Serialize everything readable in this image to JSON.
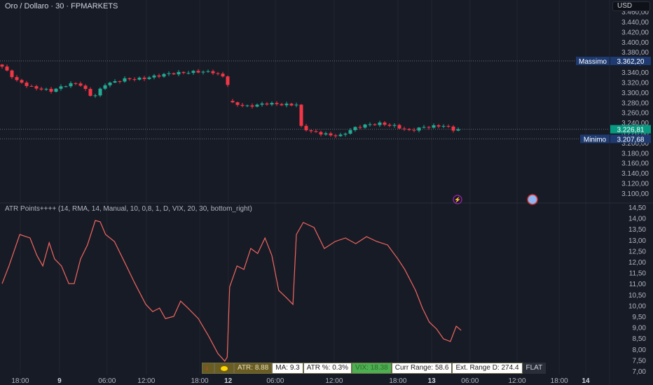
{
  "header": {
    "title": "Oro / Dollaro · 30 · FPMARKETS",
    "currency": "USD"
  },
  "indicator": {
    "label": "ATR Points++++ (14, RMA, 14, Manual, 10, 0,8, 1, D, VIX, 20, 30, bottom_right)"
  },
  "price_labels": {
    "high_label": "Massimo",
    "high_value": "3.362,20",
    "last_value": "3.226,81",
    "low_label": "Minimo",
    "low_value": "3.207,68"
  },
  "table": {
    "atr": "ATR: 8.88",
    "ma": "MA: 9.3",
    "atr_pct": "ATR %: 0.3%",
    "vix": "VIX: 18.38",
    "curr_range": "Curr Range: 58.6",
    "ext_range": "Ext. Range D: 274.4",
    "state": "FLAT",
    "arrow": "↓"
  },
  "colors": {
    "up": "#22ab94",
    "down": "#f23645",
    "atr_line": "#f2665f",
    "label_blue": "#1e3a70",
    "last_green": "#089981",
    "vix_bg": "#4caf50",
    "table_bg": "#6b5d22"
  },
  "chart_data": [
    {
      "type": "candlestick",
      "title": "Oro / Dollaro · 30 · FPMARKETS",
      "ylim": [
        3090,
        3460
      ],
      "yticks": [
        "3.460,00",
        "3.440,00",
        "3.420,00",
        "3.400,00",
        "3.380,00",
        "3.360,00",
        "3.340,00",
        "3.320,00",
        "3.300,00",
        "3.280,00",
        "3.260,00",
        "3.240,00",
        "3.220,00",
        "3.200,00",
        "3.180,00",
        "3.160,00",
        "3.140,00",
        "3.120,00",
        "3.100,00"
      ],
      "ytick_values": [
        3460,
        3440,
        3420,
        3400,
        3380,
        3360,
        3340,
        3320,
        3300,
        3280,
        3260,
        3240,
        3220,
        3200,
        3180,
        3160,
        3140,
        3120,
        3100
      ],
      "close_path": [
        [
          0,
          3351
        ],
        [
          3,
          3323
        ],
        [
          6,
          3310
        ],
        [
          10,
          3303
        ],
        [
          13.5,
          3316
        ],
        [
          15.7,
          3318
        ],
        [
          18.5,
          3289
        ],
        [
          21,
          3316
        ],
        [
          25,
          3326
        ],
        [
          28.5,
          3327
        ],
        [
          34,
          3337
        ],
        [
          40,
          3341
        ],
        [
          43,
          3340
        ],
        [
          45.7,
          3328
        ],
        [
          47,
          3278
        ],
        [
          50,
          3272
        ],
        [
          54,
          3278
        ],
        [
          58.5,
          3275
        ],
        [
          60,
          3276
        ],
        [
          60.7,
          3233
        ],
        [
          63,
          3222
        ],
        [
          67,
          3215
        ],
        [
          69,
          3214
        ],
        [
          71.5,
          3228
        ],
        [
          74,
          3235
        ],
        [
          77,
          3238
        ],
        [
          80,
          3233
        ],
        [
          83,
          3224
        ],
        [
          86,
          3231
        ],
        [
          90,
          3234
        ],
        [
          92,
          3226
        ],
        [
          93,
          3226.81
        ]
      ],
      "high": 3362.2,
      "low": 3207.68,
      "last": 3226.81
    },
    {
      "type": "line",
      "title": "ATR Points++++",
      "ylim": [
        7.0,
        14.5
      ],
      "yticks": [
        "14,50",
        "14,00",
        "13,50",
        "13,00",
        "12,50",
        "12,00",
        "11,50",
        "11,00",
        "10,50",
        "10,00",
        "9,50",
        "9,00",
        "8,50",
        "8,00",
        "7,50",
        "7,00"
      ],
      "ytick_values": [
        14.5,
        14,
        13.5,
        13,
        12.5,
        12,
        11.5,
        11,
        10.5,
        10,
        9.5,
        9,
        8.5,
        8,
        7.5,
        7
      ],
      "points": [
        [
          0,
          11.0
        ],
        [
          1.4,
          11.81
        ],
        [
          3.6,
          13.25
        ],
        [
          5.7,
          13.09
        ],
        [
          7.1,
          12.29
        ],
        [
          8.3,
          11.81
        ],
        [
          9.6,
          12.87
        ],
        [
          10.7,
          12.13
        ],
        [
          12.1,
          11.81
        ],
        [
          13.6,
          11.0
        ],
        [
          14.7,
          11.0
        ],
        [
          16,
          12.13
        ],
        [
          17.4,
          12.77
        ],
        [
          19,
          13.89
        ],
        [
          20,
          13.83
        ],
        [
          21.1,
          13.25
        ],
        [
          22.9,
          12.93
        ],
        [
          25,
          11.97
        ],
        [
          27.1,
          11.0
        ],
        [
          29.3,
          10.05
        ],
        [
          30.7,
          9.72
        ],
        [
          32.1,
          9.88
        ],
        [
          33.3,
          9.4
        ],
        [
          35,
          9.5
        ],
        [
          36.4,
          10.2
        ],
        [
          37.9,
          9.88
        ],
        [
          40,
          9.4
        ],
        [
          42.1,
          8.6
        ],
        [
          44,
          7.8
        ],
        [
          45.4,
          7.45
        ],
        [
          45.9,
          7.64
        ],
        [
          46.4,
          10.85
        ],
        [
          47.9,
          11.81
        ],
        [
          49.3,
          11.65
        ],
        [
          50.7,
          12.61
        ],
        [
          52.1,
          12.38
        ],
        [
          53.6,
          13.09
        ],
        [
          55,
          12.29
        ],
        [
          56.4,
          10.69
        ],
        [
          57.9,
          10.37
        ],
        [
          59.3,
          10.05
        ],
        [
          60,
          13.25
        ],
        [
          61.4,
          13.8
        ],
        [
          63.6,
          13.57
        ],
        [
          65.7,
          12.61
        ],
        [
          67.9,
          12.93
        ],
        [
          70,
          13.09
        ],
        [
          72.1,
          12.83
        ],
        [
          74.3,
          13.15
        ],
        [
          76.4,
          12.93
        ],
        [
          78.6,
          12.77
        ],
        [
          80.7,
          12.13
        ],
        [
          82.1,
          11.65
        ],
        [
          84.3,
          10.69
        ],
        [
          85.7,
          9.88
        ],
        [
          87.1,
          9.24
        ],
        [
          88.6,
          8.92
        ],
        [
          90,
          8.47
        ],
        [
          91.4,
          8.35
        ],
        [
          92.6,
          9.05
        ],
        [
          93.6,
          8.86
        ]
      ]
    },
    {
      "type": "time_axis",
      "labels": [
        "18:00",
        "9",
        "06:00",
        "12:00",
        "18:00",
        "12",
        "06:00",
        "12:00",
        "18:00",
        "13",
        "06:00",
        "12:00",
        "18:00",
        "14"
      ],
      "bars": [
        3.7,
        11.7,
        21.4,
        29.4,
        40.3,
        46.1,
        55.7,
        67.7,
        80.7,
        87.6,
        95.4,
        105,
        113.6,
        119
      ]
    }
  ]
}
